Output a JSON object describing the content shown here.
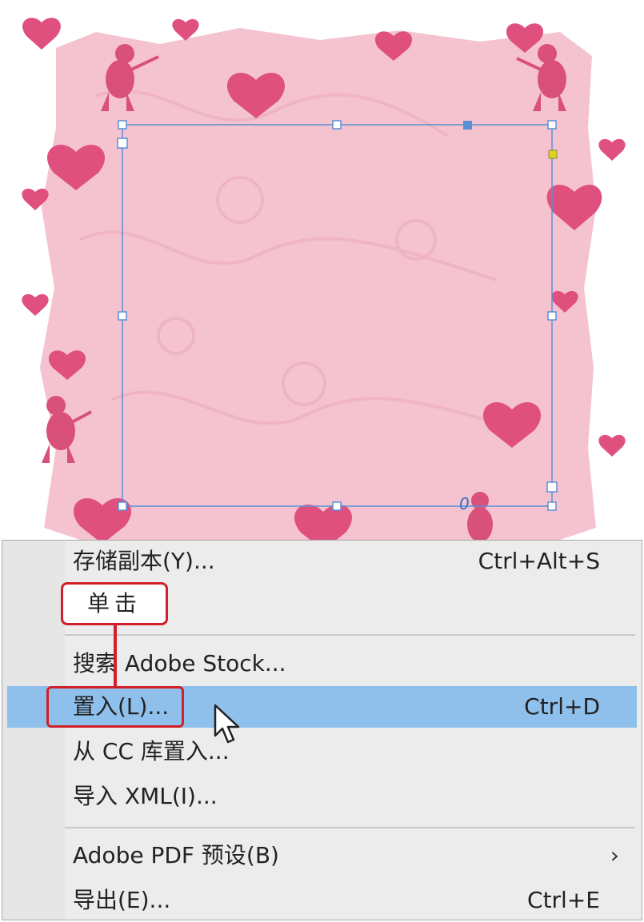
{
  "menu": {
    "items": [
      {
        "label": "存储副本(Y)...",
        "shortcut": "Ctrl+Alt+S"
      },
      {
        "label": "搜索 Adobe Stock...",
        "shortcut": ""
      },
      {
        "label": "置入(L)...",
        "shortcut": "Ctrl+D",
        "highlighted": true
      },
      {
        "label": "从 CC 库置入...",
        "shortcut": ""
      },
      {
        "label": "导入 XML(I)...",
        "shortcut": ""
      },
      {
        "label": "Adobe PDF 预设(B)",
        "shortcut": "",
        "submenu_icon": "chevron-right-icon"
      },
      {
        "label": "导出(E)...",
        "shortcut": "Ctrl+E"
      }
    ],
    "submenu_arrow": "›"
  },
  "annotation": {
    "label": "单击"
  },
  "canvas": {
    "overflow_marker": "0"
  },
  "colors": {
    "menu_bg": "#ececec",
    "highlight": "#8fc0ec",
    "annotation_red": "#d21f2a",
    "selection_blue": "#5b8fd6",
    "artwork_pink": "#f4c3cf",
    "heart_pink": "#e0507e"
  }
}
